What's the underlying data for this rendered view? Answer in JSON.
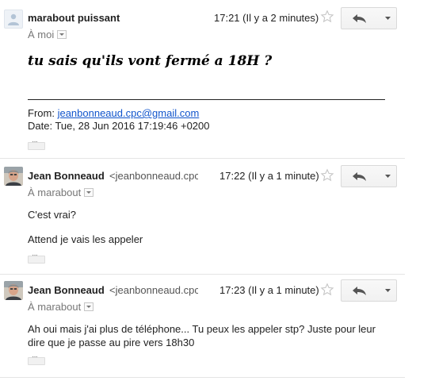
{
  "messages": [
    {
      "sender": "marabout puissant",
      "email": "",
      "time": "17:21 (Il y a 2 minutes)",
      "to": "À moi",
      "body_title": "tu sais qu'ils vont fermé a 18H ?",
      "from_label": "From:",
      "from_email": "jeanbonneaud.cpc@gmail.com",
      "date_line": "Date: Tue, 28 Jun 2016 17:19:46 +0200",
      "avatar": "generic-person-icon"
    },
    {
      "sender": "Jean Bonneaud",
      "email": "<jeanbonneaud.cpc",
      "time": "17:22 (Il y a 1 minute)",
      "to": "À marabout",
      "lines": [
        "C'est vrai?",
        "Attend je vais les appeler"
      ],
      "avatar": "photo"
    },
    {
      "sender": "Jean Bonneaud",
      "email": "<jeanbonneaud.cpc",
      "time": "17:23 (Il y a 1 minute)",
      "to": "À marabout",
      "lines": [
        "Ah oui mais j'ai plus de téléphone... Tu peux les appeler stp? Juste pour leur",
        "dire que je passe au pire vers 18h30"
      ],
      "avatar": "photo"
    }
  ],
  "colors": {
    "link": "#1155cc",
    "text": "#222222",
    "muted": "#777777",
    "divider": "#e5e5e5"
  }
}
